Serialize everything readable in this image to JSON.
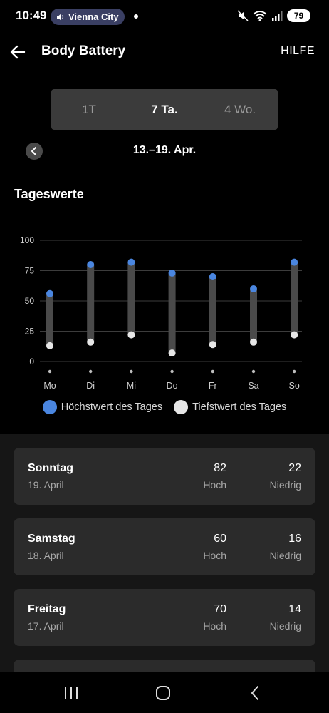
{
  "status_bar": {
    "time": "10:49",
    "media_label": "Vienna City",
    "battery": "79"
  },
  "app_bar": {
    "title": "Body Battery",
    "help": "HILFE"
  },
  "range_tabs": [
    {
      "label": "1T",
      "active": false
    },
    {
      "label": "7 Ta.",
      "active": true
    },
    {
      "label": "4 Wo.",
      "active": false
    }
  ],
  "date_range": "13.–19. Apr.",
  "section_title": "Tageswerte",
  "chart_data": {
    "type": "range-bar",
    "categories": [
      "Mo",
      "Di",
      "Mi",
      "Do",
      "Fr",
      "Sa",
      "So"
    ],
    "series": [
      {
        "name": "Höchstwert des Tages",
        "values": [
          56,
          80,
          82,
          73,
          70,
          60,
          82
        ],
        "color": "#4a86e0"
      },
      {
        "name": "Tiefstwert des Tages",
        "values": [
          13,
          16,
          22,
          7,
          14,
          16,
          22
        ],
        "color": "#e6e6e6"
      }
    ],
    "yticks": [
      0,
      25,
      50,
      75,
      100
    ],
    "ylim": [
      0,
      100
    ],
    "grid": true,
    "legend_position": "bottom"
  },
  "legend": {
    "high": "Höchstwert des Tages",
    "low": "Tiefstwert des Tages"
  },
  "day_cards": [
    {
      "day": "Sonntag",
      "date": "19. April",
      "high": "82",
      "high_label": "Hoch",
      "low": "22",
      "low_label": "Niedrig"
    },
    {
      "day": "Samstag",
      "date": "18. April",
      "high": "60",
      "high_label": "Hoch",
      "low": "16",
      "low_label": "Niedrig"
    },
    {
      "day": "Freitag",
      "date": "17. April",
      "high": "70",
      "high_label": "Hoch",
      "low": "14",
      "low_label": "Niedrig"
    }
  ],
  "colors": {
    "high": "#4a86e0",
    "low": "#e6e6e6",
    "bar": "#4a4a4a"
  }
}
